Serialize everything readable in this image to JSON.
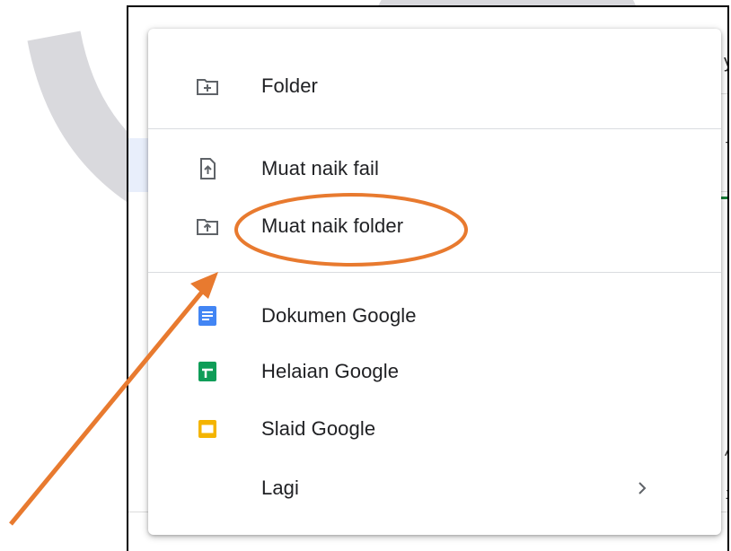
{
  "menu": {
    "items": [
      {
        "label": "Folder",
        "icon": "new-folder-icon"
      },
      {
        "label": "Muat naik fail",
        "icon": "file-upload-icon"
      },
      {
        "label": "Muat naik folder",
        "icon": "folder-upload-icon"
      },
      {
        "label": "Dokumen Google",
        "icon": "google-docs-icon"
      },
      {
        "label": "Helaian Google",
        "icon": "google-sheets-icon"
      },
      {
        "label": "Slaid Google",
        "icon": "google-slides-icon"
      },
      {
        "label": "Lagi",
        "icon": "chevron-right-icon"
      }
    ]
  },
  "colors": {
    "annotation": "#e87a2f",
    "docs_blue": "#4285f4",
    "sheets_green": "#0f9d58",
    "slides_yellow": "#f4b400",
    "icon_gray": "#5f6368"
  }
}
